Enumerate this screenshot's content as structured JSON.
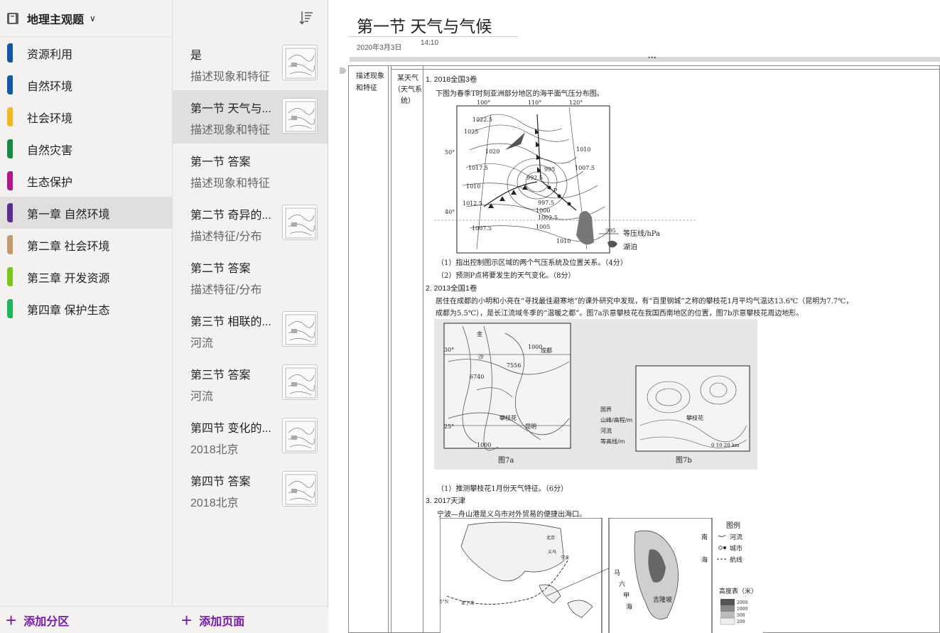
{
  "notebook": {
    "title": "地理主观题"
  },
  "sections": [
    {
      "label": "资源利用",
      "color": "#0f5aa6"
    },
    {
      "label": "自然环境",
      "color": "#0f5aa6"
    },
    {
      "label": "社会环境",
      "color": "#f4b81c"
    },
    {
      "label": "自然灾害",
      "color": "#148a3c"
    },
    {
      "label": "生态保护",
      "color": "#b4158d"
    },
    {
      "label": "第一章 自然环境",
      "color": "#5c2d91"
    },
    {
      "label": "第二章 社会环境",
      "color": "#c49a6c"
    },
    {
      "label": "第三章 开发资源",
      "color": "#7bc71e"
    },
    {
      "label": "第四章 保护生态",
      "color": "#1bb85a"
    }
  ],
  "active_section_index": 5,
  "add_section_label": "添加分区",
  "pages": [
    {
      "title": "是",
      "subtitle": "描述现象和特征"
    },
    {
      "title": "第一节 天气与...",
      "subtitle": "描述现象和特征"
    },
    {
      "title": "第一节 答案",
      "subtitle": "描述现象和特征"
    },
    {
      "title": "第二节 奇异的...",
      "subtitle": "描述特征/分布"
    },
    {
      "title": "第二节 答案",
      "subtitle": "描述特征/分布"
    },
    {
      "title": "第三节 相联的...",
      "subtitle": "河流"
    },
    {
      "title": "第三节 答案",
      "subtitle": "河流"
    },
    {
      "title": "第四节 变化的...",
      "subtitle": "2018北京"
    },
    {
      "title": "第四节 答案",
      "subtitle": "2018北京"
    }
  ],
  "active_page_index": 1,
  "add_page_label": "添加页面",
  "document": {
    "title": "第一节 天气与气候",
    "date": "2020年3月3日",
    "time": "14:10",
    "col_a": "描述现象和特征",
    "col_b": "某天气（天气系统）",
    "q1_head": "1. 2018全国3卷",
    "q1_intro": "下图为春季T时刻亚洲部分地区的海平面气压分布图。",
    "q1_legend_isobar": "等压线/hPa",
    "q1_legend_lake": "湖泊",
    "q1_sub1": "（1）指出控制图示区域的两个气压系统及位置关系。（4分）",
    "q1_sub2": "（2）预测P点将要发生的天气变化。（8分）",
    "q2_head": "2. 2013全国1卷",
    "q2_text1": "居住在成都的小明和小亮在“寻找最佳避寒地”的课外研究中发现，有“百里钢城”之称的攀枝花1月平均气温达13.6℃（昆明为7.7℃，",
    "q2_text2": "成都为5.5℃），是长江流域冬季的“温暖之都”。图7a示意攀枝花在我国西南地区的位置，图7b示意攀枝花周边地形。",
    "q2_fig_a": "图7a",
    "q2_fig_b": "图7b",
    "q2_sub1": "（1）推测攀枝花1月份天气特征。（6分）",
    "q3_head": "3. 2017天津",
    "q3_intro": "宁波—舟山港是义乌市对外贸易的便捷出海口。",
    "q3_legend_title": "图例",
    "q3_legend_river": "河流",
    "q3_legend_city": "城市",
    "q3_legend_route": "航线",
    "q3_elev": "高度表（米）"
  }
}
